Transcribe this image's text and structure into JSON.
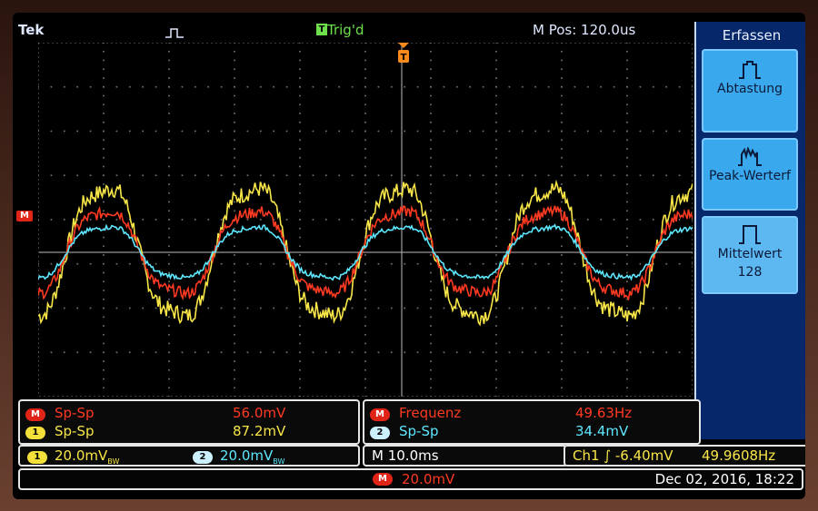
{
  "header": {
    "brand": "Tek",
    "trigger_badge": "T",
    "trigger_state": "Trig'd",
    "mpos": "M Pos: 120.0us"
  },
  "menu": {
    "title": "Erfassen",
    "items": [
      {
        "label": "Abtastung",
        "icon": "sample-mode-icon"
      },
      {
        "label": "Peak-Werterf",
        "icon": "peak-detect-icon"
      },
      {
        "label": "Mittelwert",
        "value": "128",
        "icon": "average-mode-icon"
      }
    ]
  },
  "markers": {
    "math": "M",
    "trigger_pos": "T"
  },
  "measurements": {
    "left": [
      {
        "badge": "M",
        "label": "Sp-Sp",
        "value": "56.0mV",
        "color": "#ff3a22"
      },
      {
        "badge": "1",
        "label": "Sp-Sp",
        "value": "87.2mV",
        "color": "#f8e648"
      }
    ],
    "right": [
      {
        "badge": "M",
        "label": "Frequenz",
        "value": "49.63Hz",
        "color": "#ff3a22"
      },
      {
        "badge": "2",
        "label": "Sp-Sp",
        "value": "34.4mV",
        "color": "#5ee8ff"
      }
    ]
  },
  "status": {
    "ch1_badge": "1",
    "ch1_scale": "20.0mV",
    "ch1_coupling": "BW",
    "ch2_badge": "2",
    "ch2_scale": "20.0mV",
    "ch2_coupling": "BW",
    "timebase": "M 10.0ms",
    "trigger": "Ch1 ∫ -6.40mV",
    "trigger_freq": "49.9608Hz",
    "math_badge": "M",
    "math_scale": "20.0mV",
    "datetime": "Dec 02, 2016, 18:22"
  },
  "chart_data": {
    "type": "line",
    "grid": true,
    "xlim": [
      0,
      10
    ],
    "ylim": [
      -4,
      4
    ],
    "series": [
      {
        "name": "1",
        "color": "#f8e648",
        "amplitude": 1.55,
        "noise": 0.18
      },
      {
        "name": "M",
        "color": "#ff3a22",
        "amplitude": 1.0,
        "noise": 0.12
      },
      {
        "name": "2",
        "color": "#5ee8ff",
        "amplitude": 0.62,
        "noise": 0.05
      }
    ],
    "frequency_hz": "49.63"
  }
}
